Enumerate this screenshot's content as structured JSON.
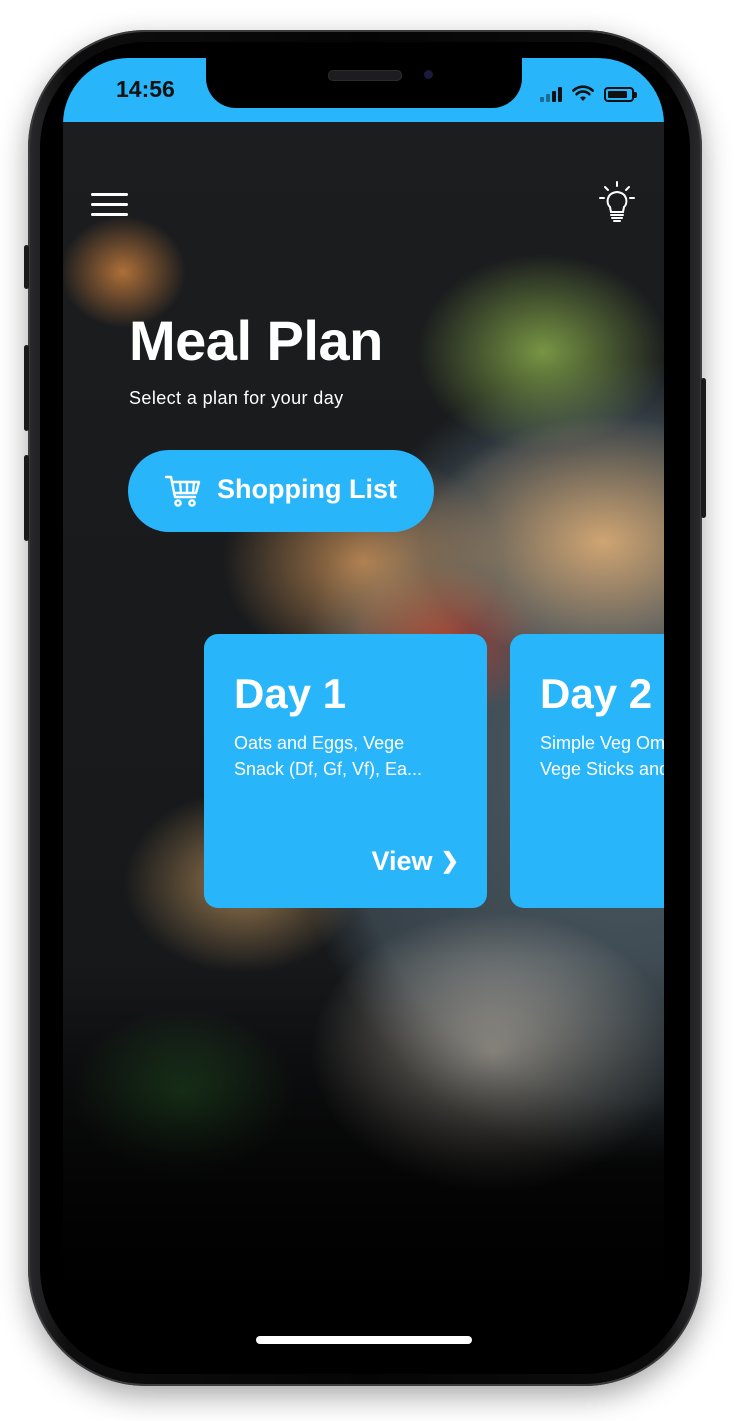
{
  "status_bar": {
    "time": "14:56",
    "background_color": "#29b5fa",
    "battery_level": 0.85,
    "icons": [
      "signal-icon",
      "wifi-icon",
      "battery-icon"
    ]
  },
  "header": {
    "menu_icon": "hamburger-menu-icon",
    "tip_icon": "lightbulb-icon"
  },
  "page": {
    "title": "Meal Plan",
    "subtitle": "Select a plan for your day"
  },
  "shopping_button": {
    "label": "Shopping List",
    "icon": "shopping-cart-icon"
  },
  "accent_color": "#29b5fa",
  "day_cards": [
    {
      "title": "Day 1",
      "description_lines": [
        "Oats and Eggs, Vege",
        "Snack (Df, Gf, Vf), Ea..."
      ],
      "action_label": "View",
      "action_icon": "chevron-right-icon"
    },
    {
      "title": "Day 2",
      "description_lines": [
        "Simple Veg Omelette,",
        "Vege Sticks and Dip,"
      ]
    }
  ]
}
